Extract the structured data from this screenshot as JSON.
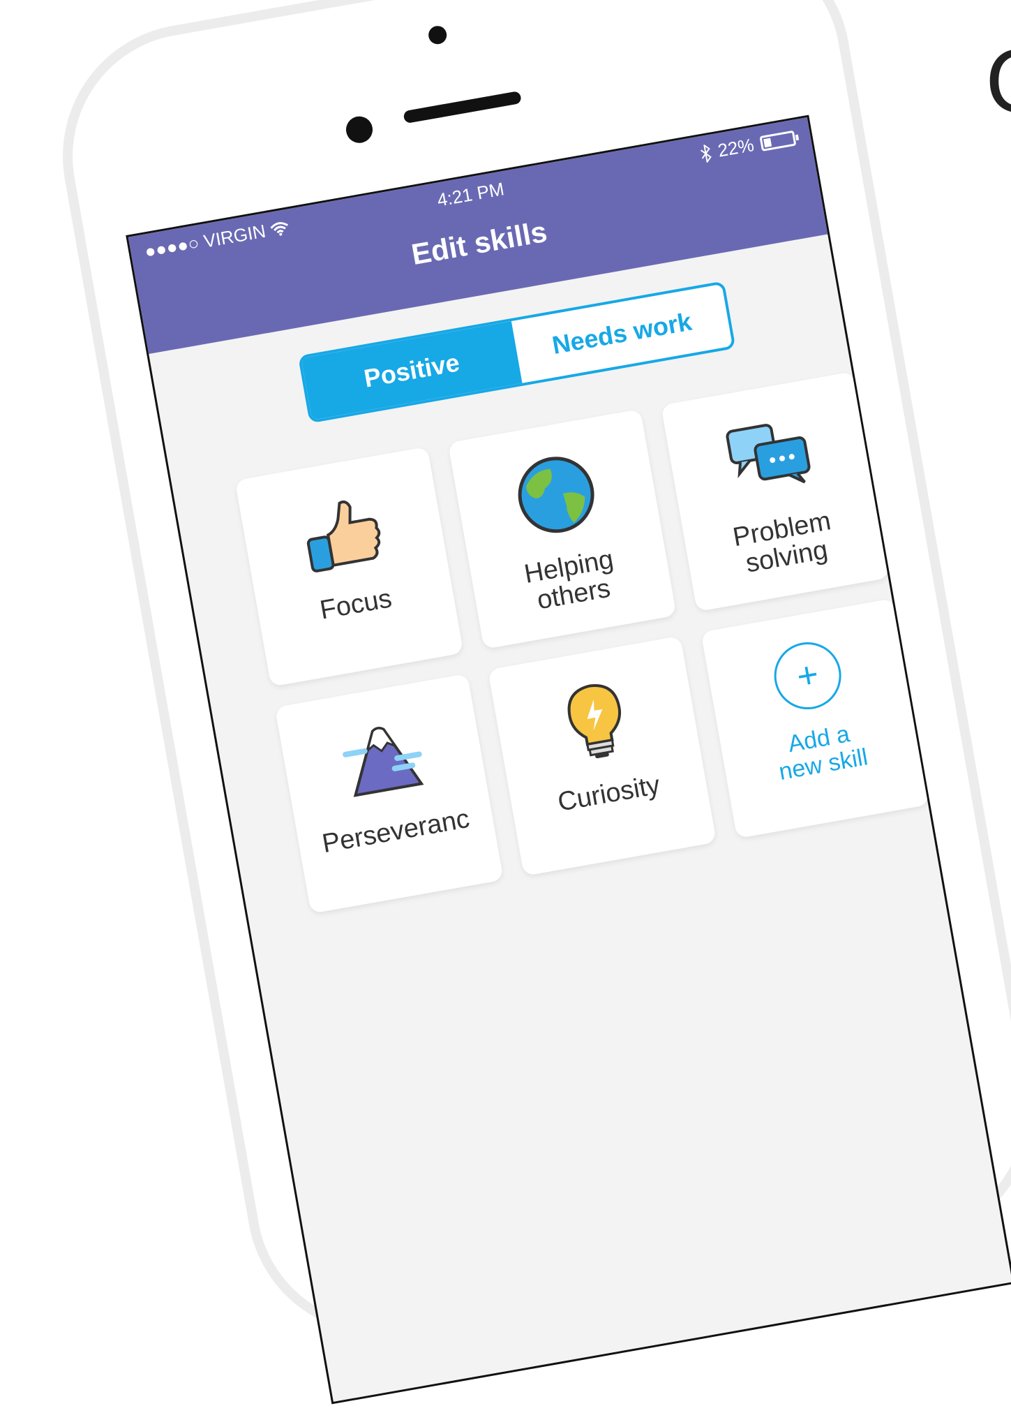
{
  "status_bar": {
    "carrier": "●●●●○ VIRGIN",
    "wifi_icon": "wifi-icon",
    "time": "4:21 PM",
    "bluetooth_icon": "bluetooth-icon",
    "battery_percent": "22%",
    "battery_level": 0.22
  },
  "header": {
    "title": "Edit skills"
  },
  "tabs": [
    {
      "label": "Positive",
      "active": true
    },
    {
      "label": "Needs work",
      "active": false
    }
  ],
  "skills": [
    {
      "label": "Focus",
      "icon": "thumbs-up-icon"
    },
    {
      "label": "Helping\nothers",
      "icon": "globe-icon"
    },
    {
      "label": "Problem\nsolving",
      "icon": "chat-bubbles-icon"
    },
    {
      "label": "Perseveranc",
      "icon": "mountain-icon"
    },
    {
      "label": "Curiosity",
      "icon": "lightbulb-icon"
    }
  ],
  "add_skill": {
    "label": "Add a\nnew skill",
    "icon_glyph": "+"
  },
  "edge_text": "C",
  "colors": {
    "header": "#6969b3",
    "accent": "#17a8e6",
    "background": "#f3f3f3"
  }
}
